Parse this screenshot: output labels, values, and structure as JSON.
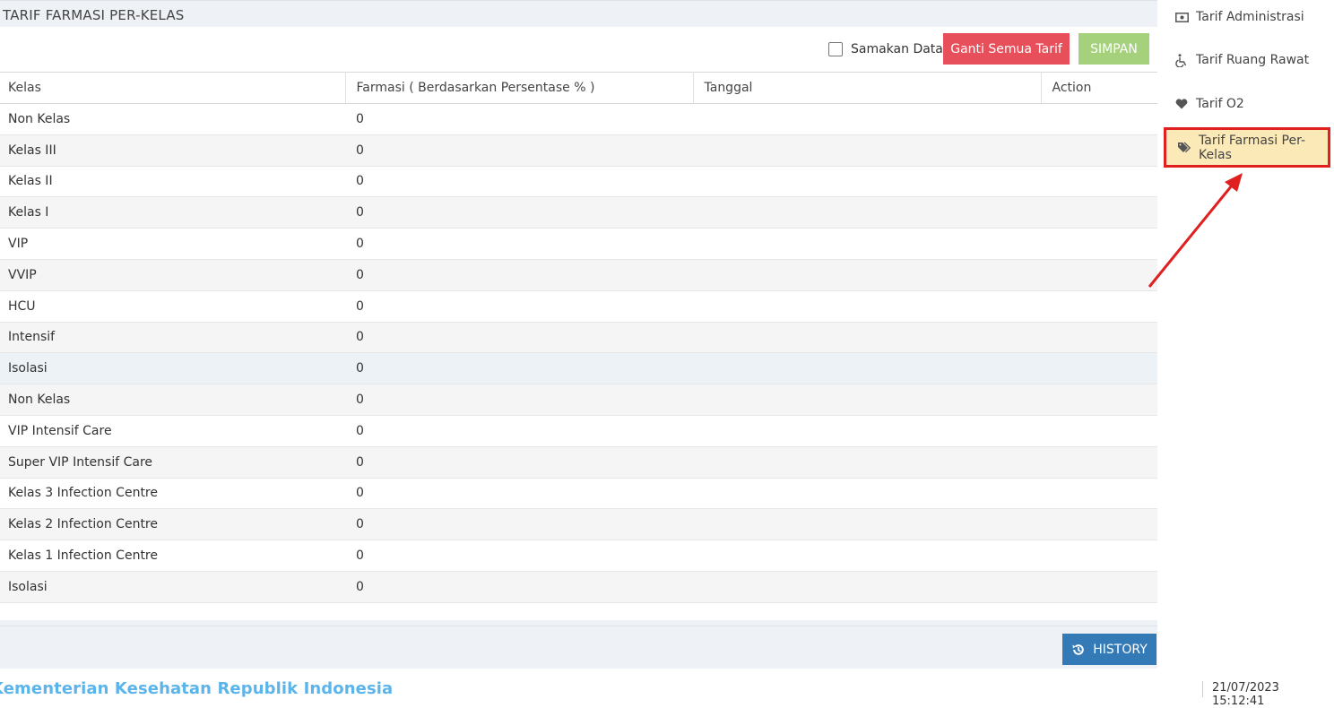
{
  "panel": {
    "title": "TARIF FARMASI PER-KELAS"
  },
  "toolbar": {
    "checkbox_label": "Samakan Data",
    "checkbox_checked": false,
    "replace_all_label": "Ganti Semua Tarif",
    "save_label": "SIMPAN"
  },
  "table": {
    "headers": [
      "Kelas",
      "Farmasi ( Berdasarkan Persentase % )",
      "Tanggal",
      "Action"
    ],
    "rows": [
      {
        "kelas": "Non Kelas",
        "farmasi": "0"
      },
      {
        "kelas": "Kelas III",
        "farmasi": "0"
      },
      {
        "kelas": "Kelas II",
        "farmasi": "0"
      },
      {
        "kelas": "Kelas I",
        "farmasi": "0"
      },
      {
        "kelas": "VIP",
        "farmasi": "0"
      },
      {
        "kelas": "VVIP",
        "farmasi": "0"
      },
      {
        "kelas": "HCU",
        "farmasi": "0"
      },
      {
        "kelas": "Intensif",
        "farmasi": "0"
      },
      {
        "kelas": "Isolasi",
        "farmasi": "0"
      },
      {
        "kelas": "Non Kelas",
        "farmasi": "0"
      },
      {
        "kelas": "VIP Intensif Care",
        "farmasi": "0"
      },
      {
        "kelas": "Super VIP Intensif Care",
        "farmasi": "0"
      },
      {
        "kelas": "Kelas 3 Infection Centre",
        "farmasi": "0"
      },
      {
        "kelas": "Kelas 2 Infection Centre",
        "farmasi": "0"
      },
      {
        "kelas": "Kelas 1 Infection Centre",
        "farmasi": "0"
      },
      {
        "kelas": "Isolasi",
        "farmasi": "0"
      }
    ]
  },
  "footer_panel": {
    "history_label": "HISTORY"
  },
  "sidebar": {
    "items": [
      {
        "label": "Tarif Administrasi",
        "icon": "money-icon"
      },
      {
        "label": "Tarif Ruang Rawat",
        "icon": "wheelchair-icon"
      },
      {
        "label": "Tarif O2",
        "icon": "heart-icon"
      },
      {
        "label": "Tarif Farmasi Per-Kelas",
        "icon": "tags-icon",
        "active": true
      }
    ]
  },
  "footer": {
    "org": "Kementerian Kesehatan Republik Indonesia",
    "datetime": "21/07/2023 15:12:41"
  },
  "colors": {
    "danger": "#e7505a",
    "success": "#a5d07c",
    "primary": "#337ab7",
    "active_bg": "#fbe9b7",
    "annotation": "#e0201f",
    "footer_org": "#5bb4ea"
  }
}
